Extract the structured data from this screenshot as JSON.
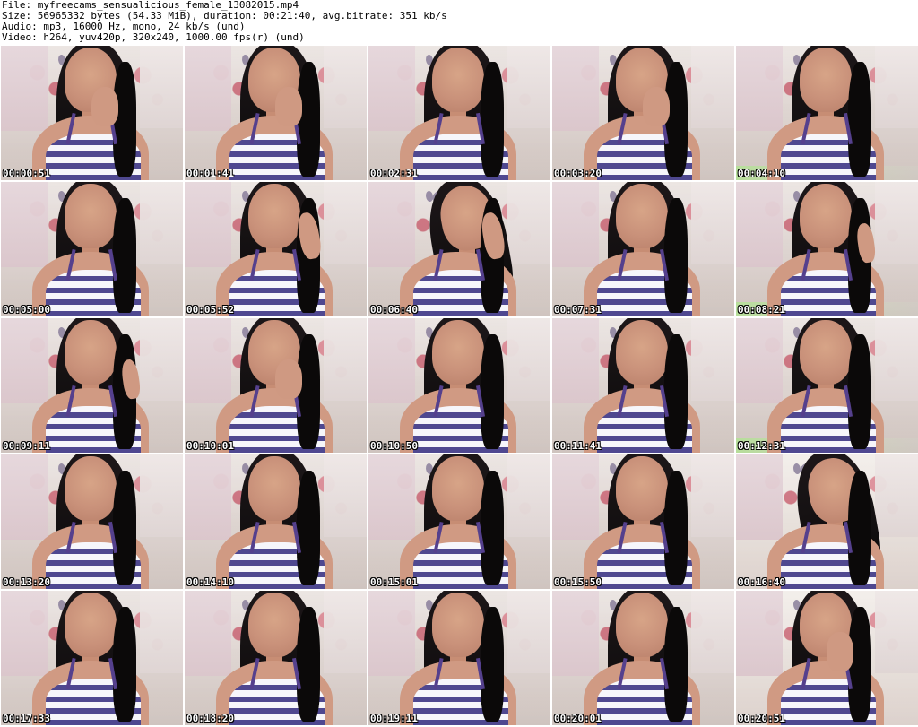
{
  "header": {
    "file": "File: myfreecams_sensualicious_female_13082015.mp4",
    "size": "Size: 56965332 bytes (54.33 MiB), duration: 00:21:40, avg.bitrate: 351 kb/s",
    "audio": "Audio: mp3, 16000 Hz, mono, 24 kb/s (und)",
    "video": "Video: h264, yuv420p, 320x240, 1000.00 fps(r) (und)"
  },
  "thumbnails": [
    {
      "timestamp": "00:00:51"
    },
    {
      "timestamp": "00:01:41"
    },
    {
      "timestamp": "00:02:31"
    },
    {
      "timestamp": "00:03:20"
    },
    {
      "timestamp": "00:04:10"
    },
    {
      "timestamp": "00:05:00"
    },
    {
      "timestamp": "00:05:52"
    },
    {
      "timestamp": "00:06:40"
    },
    {
      "timestamp": "00:07:31"
    },
    {
      "timestamp": "00:08:21"
    },
    {
      "timestamp": "00:09:11"
    },
    {
      "timestamp": "00:10:01"
    },
    {
      "timestamp": "00:10:50"
    },
    {
      "timestamp": "00:11:41"
    },
    {
      "timestamp": "00:12:31"
    },
    {
      "timestamp": "00:13:20"
    },
    {
      "timestamp": "00:14:10"
    },
    {
      "timestamp": "00:15:01"
    },
    {
      "timestamp": "00:15:50"
    },
    {
      "timestamp": "00:16:40"
    },
    {
      "timestamp": "00:17:33"
    },
    {
      "timestamp": "00:18:20"
    },
    {
      "timestamp": "00:19:11"
    },
    {
      "timestamp": "00:20:01"
    },
    {
      "timestamp": "00:20:51"
    }
  ]
}
